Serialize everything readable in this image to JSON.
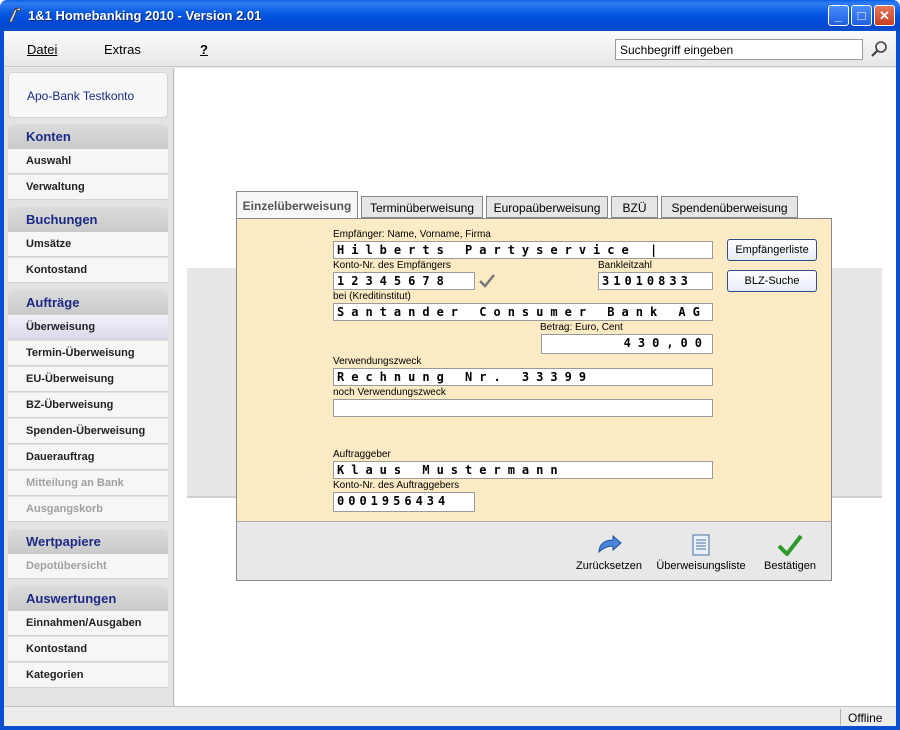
{
  "window": {
    "title": "1&1 Homebanking 2010 - Version 2.01",
    "min": "_",
    "max": "□",
    "close": "✕"
  },
  "menu": {
    "datei": "Datei",
    "extras": "Extras",
    "help": "?"
  },
  "search": {
    "placeholder": "Suchbegriff eingeben"
  },
  "sidebar": {
    "account": "Apo-Bank Testkonto",
    "sections": {
      "konten": {
        "title": "Konten",
        "items": [
          "Auswahl",
          "Verwaltung"
        ]
      },
      "buchungen": {
        "title": "Buchungen",
        "items": [
          "Umsätze",
          "Kontostand"
        ]
      },
      "auftraege": {
        "title": "Aufträge",
        "items": [
          "Überweisung",
          "Termin-Überweisung",
          "EU-Überweisung",
          "BZ-Überweisung",
          "Spenden-Überweisung",
          "Dauerauftrag",
          "Mitteilung an Bank",
          "Ausgangskorb"
        ]
      },
      "wertpapiere": {
        "title": "Wertpapiere",
        "items": [
          "Depotübersicht"
        ]
      },
      "auswertungen": {
        "title": "Auswertungen",
        "items": [
          "Einnahmen/Ausgaben",
          "Kontostand",
          "Kategorien"
        ]
      }
    }
  },
  "tabs": [
    "Einzelüberweisung",
    "Terminüberweisung",
    "Europaüberweisung",
    "BZÜ",
    "Spendenüberweisung"
  ],
  "form": {
    "recipient_label": "Empfänger: Name, Vorname, Firma",
    "recipient_value": "Hilberts Partyservice |",
    "account_label": "Konto-Nr. des Empfängers",
    "account_value": "12345678",
    "blz_label": "Bankleitzahl",
    "blz_value": "31010833",
    "bank_label": "bei (Kreditinstitut)",
    "bank_value": "Santander Consumer Bank AG",
    "amount_label": "Betrag: Euro, Cent",
    "amount_value": "430,00",
    "purpose_label": "Verwendungszweck",
    "purpose_value": "Rechnung Nr. 33399",
    "purpose2_label": "noch Verwendungszweck",
    "purpose2_value": "",
    "sender_label": "Auftraggeber",
    "sender_value": "Klaus Mustermann",
    "sender_account_label": "Konto-Nr. des Auftraggebers",
    "sender_account_value": "0001956434",
    "recipient_list_button": "Empfängerliste",
    "blz_search_button": "BLZ-Suche"
  },
  "actions": {
    "reset": "Zurücksetzen",
    "list": "Überweisungsliste",
    "confirm": "Bestätigen"
  },
  "status": {
    "connection": "Offline"
  },
  "colors": {
    "titlebar": "#0456e0",
    "form_bg": "#fdebc5",
    "nav_text": "#1c2a85"
  }
}
